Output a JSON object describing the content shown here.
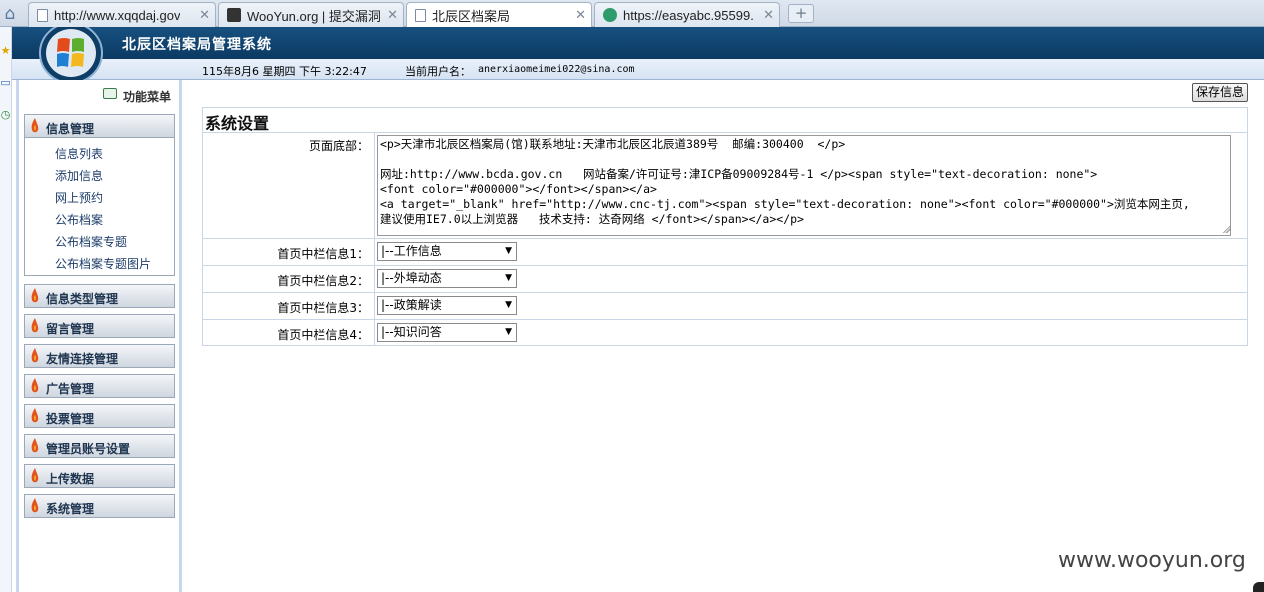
{
  "browser": {
    "tabs": [
      {
        "label": "http://www.xqqdaj.gov",
        "icon": "page-icon",
        "active": false
      },
      {
        "label": "WooYun.org | 提交漏洞",
        "icon": "wooyun-icon",
        "active": false
      },
      {
        "label": "北辰区档案局",
        "icon": "page-icon",
        "active": true
      },
      {
        "label": "https://easyabc.95599.",
        "icon": "globe-icon",
        "active": false
      }
    ],
    "new_tab": "+",
    "close_glyph": "✕"
  },
  "header": {
    "title": "北辰区档案局管理系统",
    "datetime": "115年8月6 星期四 下午 3:22:47",
    "current_user_label": "当前用户名：",
    "current_user": "anerxiaomeimei022@sina.com",
    "header_color": "#0f4470"
  },
  "sidebar": {
    "menu_title": "功能菜单",
    "sections": [
      {
        "label": "信息管理",
        "expanded": true
      },
      {
        "label": "信息类型管理"
      },
      {
        "label": "留言管理"
      },
      {
        "label": "友情连接管理"
      },
      {
        "label": "广告管理"
      },
      {
        "label": "投票管理"
      },
      {
        "label": "管理员账号设置"
      },
      {
        "label": "上传数据"
      },
      {
        "label": "系统管理"
      }
    ],
    "subitems": [
      "信息列表",
      "添加信息",
      "网上预约",
      "公布档案",
      "公布档案专题",
      "公布档案专题图片"
    ]
  },
  "main": {
    "save_label": "保存信息",
    "title": "系统设置",
    "footer_label": "页面底部：",
    "footer_value": "<p>天津市北辰区档案局(馆)联系地址:天津市北辰区北辰道389号  邮编:300400  </p>\n\n网址:http://www.bcda.gov.cn   网站备案/许可证号:津ICP备09009284号-1 </p><span style=\"text-decoration: none\">\n<font color=\"#000000\"></font></span></a>\n<a target=\"_blank\" href=\"http://www.cnc-tj.com\"><span style=\"text-decoration: none\"><font color=\"#000000\">浏览本网主页,\n建议使用IE7.0以上浏览器   技术支持: 达奇网络 </font></span></a></p>",
    "columns": [
      {
        "label": "首页中栏信息1：",
        "value": "|--工作信息"
      },
      {
        "label": "首页中栏信息2：",
        "value": "|--外埠动态"
      },
      {
        "label": "首页中栏信息3：",
        "value": "|--政策解读"
      },
      {
        "label": "首页中栏信息4：",
        "value": "|--知识问答"
      }
    ]
  },
  "watermark": "www.wooyun.org"
}
